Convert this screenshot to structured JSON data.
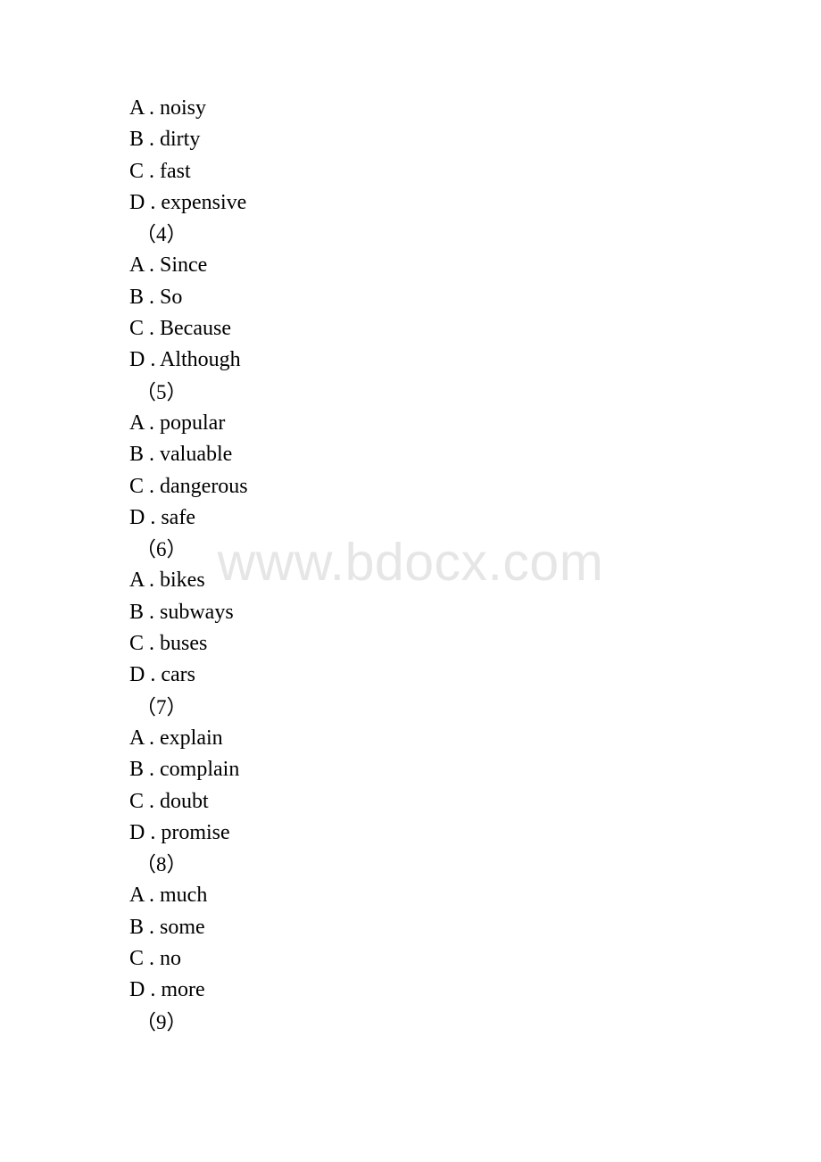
{
  "page": {
    "watermark": "www.bdocx.com",
    "watermark_color": "#e6e6e6",
    "background_color": "#ffffff",
    "text_color": "#000000"
  },
  "lines": [
    {
      "kind": "option",
      "text": "A . noisy"
    },
    {
      "kind": "option",
      "text": "B . dirty"
    },
    {
      "kind": "option",
      "text": "C . fast"
    },
    {
      "kind": "option",
      "text": "D . expensive"
    },
    {
      "kind": "question",
      "text": "（4）"
    },
    {
      "kind": "option",
      "text": "A . Since"
    },
    {
      "kind": "option",
      "text": "B . So"
    },
    {
      "kind": "option",
      "text": "C . Because"
    },
    {
      "kind": "option",
      "text": "D . Although"
    },
    {
      "kind": "question",
      "text": "（5）"
    },
    {
      "kind": "option",
      "text": "A . popular"
    },
    {
      "kind": "option",
      "text": "B . valuable"
    },
    {
      "kind": "option",
      "text": "C . dangerous"
    },
    {
      "kind": "option",
      "text": "D . safe"
    },
    {
      "kind": "question",
      "text": "（6）"
    },
    {
      "kind": "option",
      "text": "A . bikes"
    },
    {
      "kind": "option",
      "text": "B . subways"
    },
    {
      "kind": "option",
      "text": "C . buses"
    },
    {
      "kind": "option",
      "text": "D . cars"
    },
    {
      "kind": "question",
      "text": "（7）"
    },
    {
      "kind": "option",
      "text": "A . explain"
    },
    {
      "kind": "option",
      "text": "B . complain"
    },
    {
      "kind": "option",
      "text": "C . doubt"
    },
    {
      "kind": "option",
      "text": "D . promise"
    },
    {
      "kind": "question",
      "text": "（8）"
    },
    {
      "kind": "option",
      "text": "A . much"
    },
    {
      "kind": "option",
      "text": "B . some"
    },
    {
      "kind": "option",
      "text": "C . no"
    },
    {
      "kind": "option",
      "text": "D . more"
    },
    {
      "kind": "question",
      "text": "（9）"
    }
  ]
}
